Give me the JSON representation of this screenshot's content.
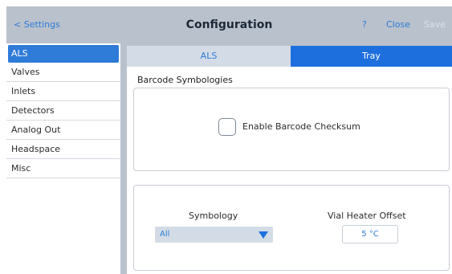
{
  "header": {
    "back_label": "< Settings",
    "title": "Configuration",
    "help_label": "?",
    "close_label": "Close",
    "save_label": "Save"
  },
  "sidebar": {
    "items": [
      {
        "label": "ALS",
        "active": true
      },
      {
        "label": "Valves"
      },
      {
        "label": "Inlets"
      },
      {
        "label": "Detectors"
      },
      {
        "label": "Analog Out"
      },
      {
        "label": "Headspace"
      },
      {
        "label": "Misc"
      }
    ]
  },
  "tabs": [
    {
      "label": "ALS",
      "selected": false
    },
    {
      "label": "Tray",
      "selected": true
    }
  ],
  "main": {
    "section_title": "Barcode Symbologies",
    "checksum": {
      "label": "Enable Barcode Checksum",
      "checked": false
    },
    "symbology": {
      "label": "Symbology",
      "value": "All"
    },
    "vial_heater_offset": {
      "label": "Vial Heater Offset",
      "value": "5 °C"
    }
  },
  "colors": {
    "accent": "#2f7bd8",
    "tab_selected": "#1d6fde",
    "header_bg": "#b9c1cc"
  }
}
